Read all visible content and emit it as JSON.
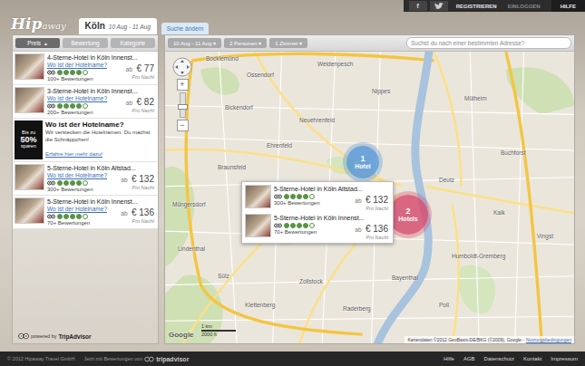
{
  "top_bar": {
    "facebook": "f",
    "links": [
      {
        "label": "REGISTRIEREN",
        "disabled": false
      },
      {
        "label": "EINLOGGEN",
        "disabled": true
      }
    ],
    "help": "HILFE"
  },
  "logo": {
    "main": "Hip",
    "suffix": "away"
  },
  "search_tab": {
    "city": "Köln",
    "dates": "10 Aug - 11 Aug",
    "selected": true
  },
  "change_search": {
    "label": "Suche ändern"
  },
  "sort_buttons": [
    {
      "label": "Preis",
      "arrow": "▲",
      "selected": true
    },
    {
      "label": "Bewertung",
      "selected": false
    },
    {
      "label": "Kategorie",
      "selected": false
    }
  ],
  "filters": [
    {
      "label": "10 Aug - 11 Aug",
      "arrow": "▾"
    },
    {
      "label": "2 Personen",
      "arrow": "▾"
    },
    {
      "label": "1 Zimmer",
      "arrow": "▾"
    }
  ],
  "search": {
    "placeholder": "Suchst du nach einer bestimmten Adresse?"
  },
  "results": [
    {
      "kind": "hotel",
      "title": "4-Sterne-Hotel in Köln Innenst...",
      "link": "Wo ist der Hotelname?",
      "stars": 4,
      "reviews": "100+ Bewertungen",
      "price_prefix": "ab",
      "price": "€ 77",
      "unit": "Pro Nacht"
    },
    {
      "kind": "hotel",
      "title": "3-Sterne-Hotel in Köln Innenst...",
      "link": "Wo ist der Hotelname?",
      "stars": 4,
      "reviews": "200+ Bewertungen",
      "price_prefix": "ab",
      "price": "€ 82",
      "unit": "Pro Nacht"
    },
    {
      "kind": "promo",
      "badge": [
        "Bis zu",
        "50%",
        "sparen"
      ],
      "title": "Wo ist der Hotelname?",
      "text": "Wir verstecken die Hotelnamen. Du machst die Schnäppchen!",
      "link": "Erfahre hier mehr dazu!"
    },
    {
      "kind": "hotel",
      "title": "5-Sterne-Hotel in Köln Altstad...",
      "link": "Wo ist der Hotelname?",
      "stars": 4,
      "reviews": "300+ Bewertungen",
      "price_prefix": "ab",
      "price": "€ 132",
      "unit": "Pro Nacht"
    },
    {
      "kind": "hotel",
      "title": "5-Sterne-Hotel in Köln Innenst...",
      "link": "Wo ist der Hotelname?",
      "stars": 4,
      "reviews": "70+ Bewertungen",
      "price_prefix": "ab",
      "price": "€ 136",
      "unit": "Pro Nacht"
    }
  ],
  "powered_by": {
    "prefix": "powered by",
    "brand": "TripAdvisor"
  },
  "map": {
    "zoom_in": "+",
    "zoom_out": "−",
    "clusters": [
      {
        "count": "1",
        "label": "Hotel",
        "color": "#4f93d8"
      },
      {
        "count": "2",
        "label": "Hotels",
        "color": "#d6476b"
      }
    ],
    "popup": [
      {
        "title": "5-Sterne-Hotel in Köln Altstad...",
        "stars": 4,
        "reviews": "300+ Bewertungen",
        "price_prefix": "ab",
        "price": "€ 132",
        "unit": "Pro Nacht"
      },
      {
        "title": "5-Sterne-Hotel in Köln Innenst...",
        "stars": 4,
        "reviews": "70+ Bewertungen",
        "price_prefix": "ab",
        "price": "€ 136",
        "unit": "Pro Nacht"
      }
    ],
    "places": [
      "Bocklemünd",
      "Ossendorf",
      "Weidenpesch",
      "Nippes",
      "Mülheim",
      "Bickendorf",
      "Neuehrenfeld",
      "Ehrenfeld",
      "Braunsfeld",
      "Buchforst",
      "Müngersdorf",
      "Deutz",
      "Kalk",
      "Lindenthal",
      "Vingst",
      "Humboldt-Gremberg",
      "Sülz",
      "Zollstock",
      "Bayenthal",
      "Klettenberg",
      "Raderberg",
      "Poll"
    ],
    "scale": {
      "metric": "1 km",
      "imperial": "2000 ft"
    },
    "google": "Google",
    "attribution": "Kartendaten ©2012 GeoBasis-DE/BKG (©2009), Google -",
    "terms": "Nutzungsbedingungen"
  },
  "footer": {
    "copyright": "© 2012 Hipaway Travel GmbH",
    "reviews_note": "Jetzt mit Bewertungen von",
    "reviews_brand": "tripadvisor",
    "links": [
      "Hilfe",
      "AGB",
      "Datenschutz",
      "Kontakt",
      "Impressum"
    ]
  }
}
